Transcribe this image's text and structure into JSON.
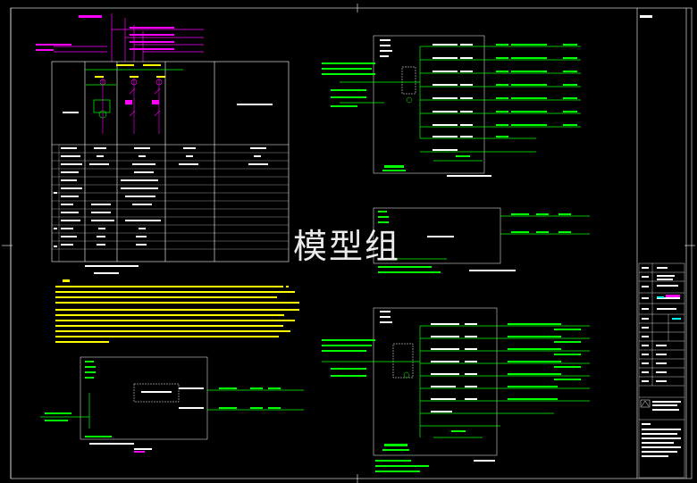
{
  "watermark": {
    "text": "模型组"
  },
  "colors": {
    "background": "#000000",
    "frame": "#ffffff",
    "wire": "#00ff00",
    "device": "#ff00ff",
    "box": "#ffffff",
    "accent": "#ffff00",
    "label": "#00ffff",
    "stamp": "#ff0000"
  },
  "title_block": {
    "rows": 16
  },
  "icons": [
    "cad-frame-icon",
    "panel-diagram-icon",
    "title-block-icon",
    "company-logo-icon"
  ]
}
